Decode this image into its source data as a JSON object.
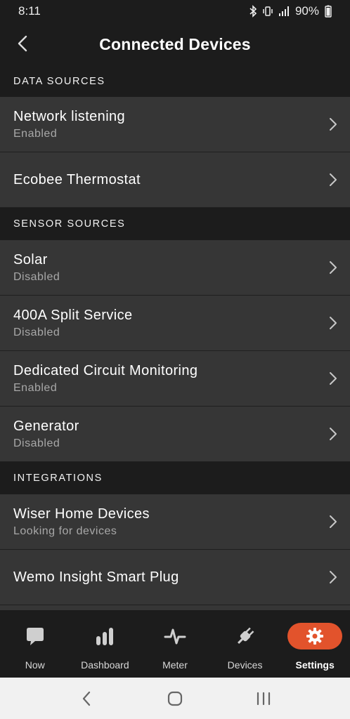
{
  "status_bar": {
    "time": "8:11",
    "battery": "90%"
  },
  "header": {
    "title": "Connected Devices"
  },
  "sections": [
    {
      "header": "DATA SOURCES",
      "items": [
        {
          "title": "Network listening",
          "subtitle": "Enabled"
        },
        {
          "title": "Ecobee Thermostat",
          "subtitle": ""
        }
      ]
    },
    {
      "header": "SENSOR SOURCES",
      "items": [
        {
          "title": "Solar",
          "subtitle": "Disabled"
        },
        {
          "title": "400A Split Service",
          "subtitle": "Disabled"
        },
        {
          "title": "Dedicated Circuit Monitoring",
          "subtitle": "Enabled"
        },
        {
          "title": "Generator",
          "subtitle": "Disabled"
        }
      ]
    },
    {
      "header": "INTEGRATIONS",
      "items": [
        {
          "title": "Wiser Home Devices",
          "subtitle": "Looking for devices"
        },
        {
          "title": "Wemo Insight Smart Plug",
          "subtitle": ""
        }
      ]
    }
  ],
  "tabs": [
    {
      "label": "Now",
      "icon": "chat-bubble-icon",
      "active": false
    },
    {
      "label": "Dashboard",
      "icon": "bar-chart-icon",
      "active": false
    },
    {
      "label": "Meter",
      "icon": "pulse-icon",
      "active": false
    },
    {
      "label": "Devices",
      "icon": "plug-icon",
      "active": false
    },
    {
      "label": "Settings",
      "icon": "gear-icon",
      "active": true
    }
  ],
  "colors": {
    "accent": "#e2532c",
    "row_bg": "#363636",
    "app_bg": "#1c1c1c"
  }
}
